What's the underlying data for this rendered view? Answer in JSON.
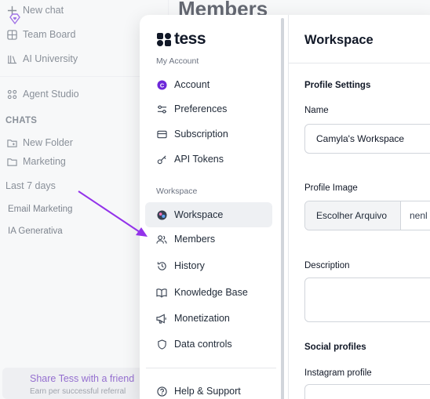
{
  "background": {
    "sidebar": {
      "new_chat": "New chat",
      "team_board": "Team Board",
      "ai_university": "AI University",
      "agent_studio": "Agent Studio",
      "chats_header": "CHATS",
      "new_folder": "New Folder",
      "folder_marketing": "Marketing",
      "last7_header": "Last 7 days",
      "recent_chats": [
        "Email Marketing",
        "IA Generativa"
      ],
      "share_title": "Share Tess with a friend",
      "share_subtitle": "Earn per successful referral"
    },
    "page_heading": "Members"
  },
  "modal": {
    "logo_text": "tess",
    "nav": {
      "my_account_header": "My Account",
      "account": "Account",
      "preferences": "Preferences",
      "subscription": "Subscription",
      "api_tokens": "API Tokens",
      "workspace_header": "Workspace",
      "workspace": "Workspace",
      "members": "Members",
      "history": "History",
      "knowledge_base": "Knowledge Base",
      "monetization": "Monetization",
      "data_controls": "Data controls",
      "help_support": "Help & Support"
    },
    "content": {
      "title": "Workspace",
      "profile_settings": "Profile Settings",
      "name_label": "Name",
      "name_value": "Camyla's Workspace",
      "profile_image_label": "Profile Image",
      "file_button": "Escolher Arquivo",
      "file_status": "nenl",
      "description_label": "Description",
      "social_profiles": "Social profiles",
      "instagram_label": "Instagram profile"
    }
  },
  "colors": {
    "accent": "#6d28d9",
    "arrow": "#9333ea"
  }
}
